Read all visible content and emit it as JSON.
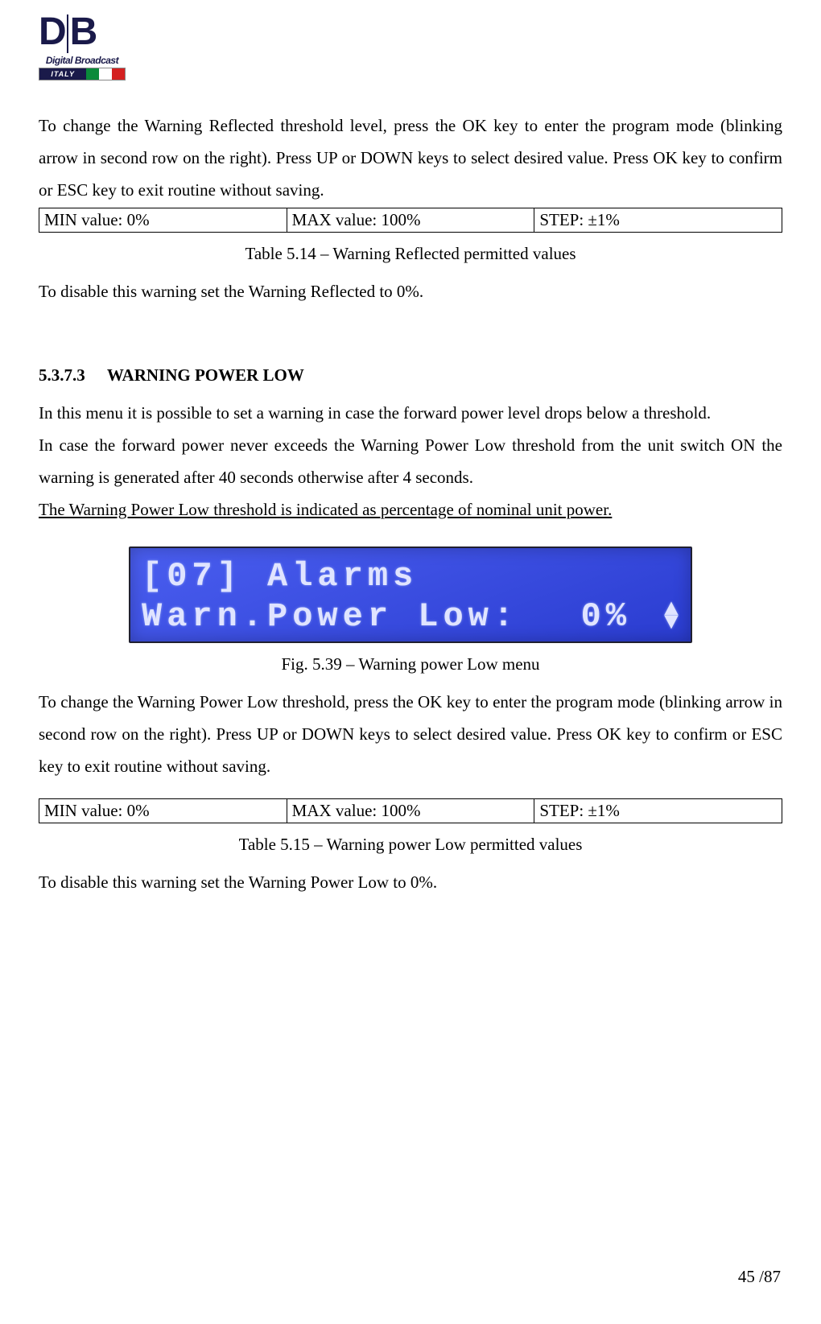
{
  "logo": {
    "letters": "DB",
    "subtitle": "Digital Broadcast",
    "flag_label": "ITALY"
  },
  "p1": "To change the Warning Reflected threshold level, press the OK key to enter the program mode (blinking arrow in second row on the right). Press UP or DOWN keys to select desired value. Press OK key to confirm or ESC key to exit routine without saving.",
  "table1": {
    "min": "MIN value: 0%",
    "max": "MAX value: 100%",
    "step": "STEP: ±1%"
  },
  "caption1": "Table 5.14 – Warning Reflected permitted values",
  "p2": "To disable this warning set the Warning Reflected to 0%.",
  "section": {
    "num": "5.3.7.3",
    "title": "WARNING POWER LOW"
  },
  "p3": "In this menu it is possible to set a warning in case the forward power level drops below a threshold.",
  "p4": "In case the forward power never exceeds the Warning Power Low threshold from the unit switch ON the warning is generated after 40 seconds otherwise after 4 seconds.",
  "p5": "The Warning Power Low threshold is indicated as percentage of nominal unit power.",
  "lcd": {
    "row1": "[07] Alarms",
    "row2_left": "Warn.Power Low:",
    "row2_right": "0%"
  },
  "caption2": "Fig. 5.39 – Warning power Low menu",
  "p6": "To change the Warning Power Low threshold, press the OK key to enter the program mode (blinking arrow in second row on the right). Press UP or DOWN keys to select desired value. Press OK key to confirm or ESC key to exit routine without saving.",
  "table2": {
    "min": "MIN value: 0%",
    "max": "MAX value: 100%",
    "step": "STEP: ±1%"
  },
  "caption3": "Table 5.15 – Warning power Low permitted values",
  "p7": "To disable this warning set the Warning Power Low to 0%.",
  "page_number": "45 /87"
}
